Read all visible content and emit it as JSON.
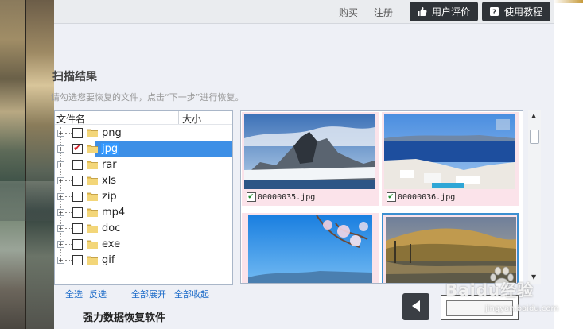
{
  "topbar": {
    "buy": "购买",
    "register": "注册",
    "reviews_btn": "用户评价",
    "tutorial_btn": "使用教程"
  },
  "scan": {
    "title": "扫描结果",
    "hint": "请勾选您要恢复的文件，点击“下一步”进行恢复。"
  },
  "tree": {
    "col_name": "文件名",
    "col_size": "大小",
    "items": [
      {
        "label": "png",
        "checked": false,
        "selected": false
      },
      {
        "label": "jpg",
        "checked": true,
        "selected": true
      },
      {
        "label": "rar",
        "checked": false,
        "selected": false
      },
      {
        "label": "xls",
        "checked": false,
        "selected": false
      },
      {
        "label": "zip",
        "checked": false,
        "selected": false
      },
      {
        "label": "mp4",
        "checked": false,
        "selected": false
      },
      {
        "label": "doc",
        "checked": false,
        "selected": false
      },
      {
        "label": "exe",
        "checked": false,
        "selected": false
      },
      {
        "label": "gif",
        "checked": false,
        "selected": false
      }
    ]
  },
  "actions": {
    "select_all": "全选",
    "invert": "反选",
    "expand_all": "全部展开",
    "collapse_all": "全部收起"
  },
  "preview": {
    "thumbs": [
      {
        "name": "00000035.jpg",
        "checked": true
      },
      {
        "name": "00000036.jpg",
        "checked": true
      },
      {
        "name": "",
        "checked": false
      },
      {
        "name": "",
        "checked": false
      }
    ]
  },
  "footer": {
    "brand": "强力数据恢复软件"
  },
  "watermark": {
    "text": "Baidu经验",
    "sub": "jingyan.baidu.com"
  },
  "colors": {
    "accent": "#3399ff",
    "button_dark": "#2f3338",
    "thumb_bg": "#fbe3ea",
    "link": "#1a6ac8"
  }
}
